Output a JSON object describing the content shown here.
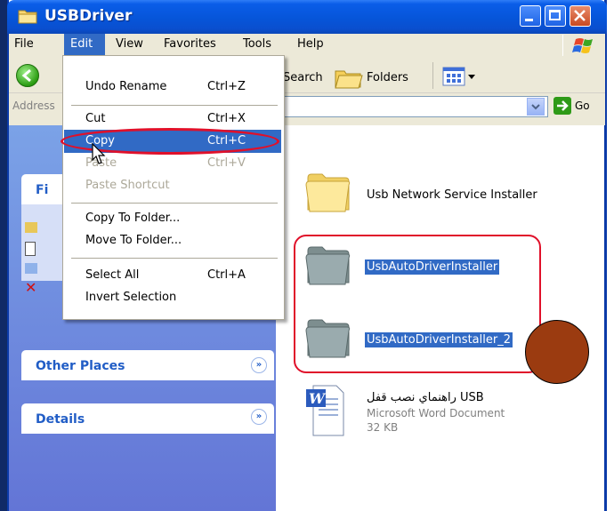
{
  "window": {
    "title": "USBDriver"
  },
  "menubar": {
    "items": [
      "File",
      "Edit",
      "View",
      "Favorites",
      "Tools",
      "Help"
    ]
  },
  "toolbar": {
    "search_label": "Search",
    "folders_label": "Folders"
  },
  "addressbar": {
    "label": "Address",
    "go_label": "Go"
  },
  "edit_menu": {
    "undo": {
      "label": "Undo Rename",
      "shortcut": "Ctrl+Z"
    },
    "cut": {
      "label": "Cut",
      "shortcut": "Ctrl+X"
    },
    "copy": {
      "label": "Copy",
      "shortcut": "Ctrl+C"
    },
    "paste": {
      "label": "Paste",
      "shortcut": "Ctrl+V"
    },
    "paste_shortcut": {
      "label": "Paste Shortcut"
    },
    "copy_to": {
      "label": "Copy To Folder..."
    },
    "move_to": {
      "label": "Move To Folder..."
    },
    "select_all": {
      "label": "Select All",
      "shortcut": "Ctrl+A"
    },
    "invert": {
      "label": "Invert Selection"
    }
  },
  "taskpane": {
    "file_tasks_title": "Fi",
    "other_places_title": "Other Places",
    "details_title": "Details"
  },
  "files": [
    {
      "name": "Usb Network Service Installer",
      "type": "folder"
    },
    {
      "name": "UsbAutoDriverInstaller",
      "type": "folder",
      "selected": true
    },
    {
      "name": "UsbAutoDriverInstaller_2",
      "type": "folder",
      "selected": true
    },
    {
      "name": "راهنماي نصب قفل USB",
      "type": "document",
      "subtitle": "Microsoft Word Document",
      "size": "32 KB"
    }
  ],
  "colors": {
    "titlebar": "#0655d9",
    "selection": "#316ac5",
    "highlight_outline": "#e0102a",
    "marker_dot": "#9b3b10"
  }
}
